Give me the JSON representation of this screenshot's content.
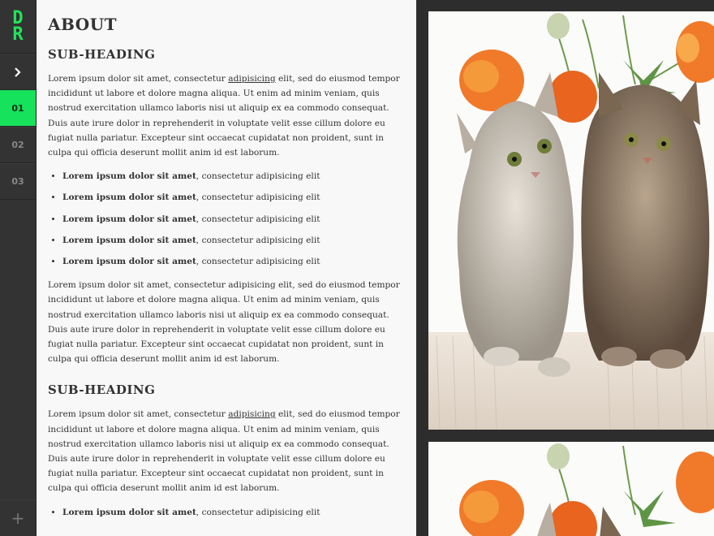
{
  "sidebar": {
    "logo_line1": "D",
    "logo_line2": "R",
    "toggle_icon": "chevron-right-icon",
    "items": [
      {
        "label": "01",
        "active": true
      },
      {
        "label": "02",
        "active": false
      },
      {
        "label": "03",
        "active": false
      }
    ],
    "add_label": "+"
  },
  "content": {
    "title": "ABOUT",
    "sections": [
      {
        "heading": "SUB-HEADING",
        "para1_before": "Lorem ipsum dolor sit amet, consectetur ",
        "para1_link": "adipisicing",
        "para1_after": " elit, sed do eiusmod tempor incididunt ut labore et dolore magna aliqua. Ut enim ad minim veniam, quis nostrud exercitation ullamco laboris nisi ut aliquip ex ea commodo consequat. Duis aute irure dolor in reprehenderit in voluptate velit esse cillum dolore eu fugiat nulla pariatur. Excepteur sint occaecat cupidatat non proident, sunt in culpa qui officia deserunt mollit anim id est laborum.",
        "list": [
          {
            "bold": "Lorem ipsum dolor sit amet",
            "rest": ", consectetur adipisicing elit"
          },
          {
            "bold": "Lorem ipsum dolor sit amet",
            "rest": ", consectetur adipisicing elit"
          },
          {
            "bold": "Lorem ipsum dolor sit amet",
            "rest": ", consectetur adipisicing elit"
          },
          {
            "bold": "Lorem ipsum dolor sit amet",
            "rest": ", consectetur adipisicing elit"
          },
          {
            "bold": "Lorem ipsum dolor sit amet",
            "rest": ", consectetur adipisicing elit"
          }
        ],
        "para2": "Lorem ipsum dolor sit amet, consectetur adipisicing elit, sed do eiusmod tempor incididunt ut labore et dolore magna aliqua. Ut enim ad minim veniam, quis nostrud exercitation ullamco laboris nisi ut aliquip ex ea commodo consequat. Duis aute irure dolor in reprehenderit in voluptate velit esse cillum dolore eu fugiat nulla pariatur. Excepteur sint occaecat cupidatat non proident, sunt in culpa qui officia deserunt mollit anim id est laborum."
      },
      {
        "heading": "SUB-HEADING",
        "para1_before": "Lorem ipsum dolor sit amet, consectetur ",
        "para1_link": "adipisicing",
        "para1_after": " elit, sed do eiusmod tempor incididunt ut labore et dolore magna aliqua. Ut enim ad minim veniam, quis nostrud exercitation ullamco laboris nisi ut aliquip ex ea commodo consequat. Duis aute irure dolor in reprehenderit in voluptate velit esse cillum dolore eu fugiat nulla pariatur. Excepteur sint occaecat cupidatat non proident, sunt in culpa qui officia deserunt mollit anim id est laborum.",
        "list": [
          {
            "bold": "Lorem ipsum dolor sit amet",
            "rest": ", consectetur adipisicing elit"
          }
        ]
      }
    ]
  },
  "colors": {
    "accent": "#16e25b",
    "sidebar_bg": "#333333",
    "content_bg": "#f8f8f8",
    "gallery_bg": "#2d2d2d"
  }
}
